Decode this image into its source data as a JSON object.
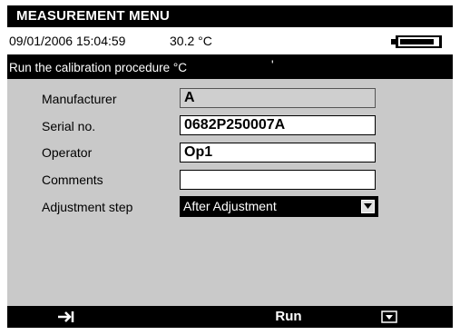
{
  "header": {
    "title": "MEASUREMENT MENU"
  },
  "status": {
    "datetime": "09/01/2006 15:04:59",
    "temperature": "30.2 °C",
    "battery_level": 0.9
  },
  "procedure": {
    "text": "Run the calibration procedure °C",
    "mark": "'"
  },
  "form": {
    "manufacturer": {
      "label": "Manufacturer",
      "value": "A"
    },
    "serial": {
      "label": "Serial no.",
      "value": "0682P250007A"
    },
    "operator": {
      "label": "Operator",
      "value": "Op1"
    },
    "comments": {
      "label": "Comments",
      "value": ""
    },
    "adjustment": {
      "label": "Adjustment step",
      "value": "After Adjustment"
    }
  },
  "softkeys": {
    "left_icon": "tab-arrow-icon",
    "middle_label": "Run",
    "right_icon": "dropdown-box-icon"
  }
}
